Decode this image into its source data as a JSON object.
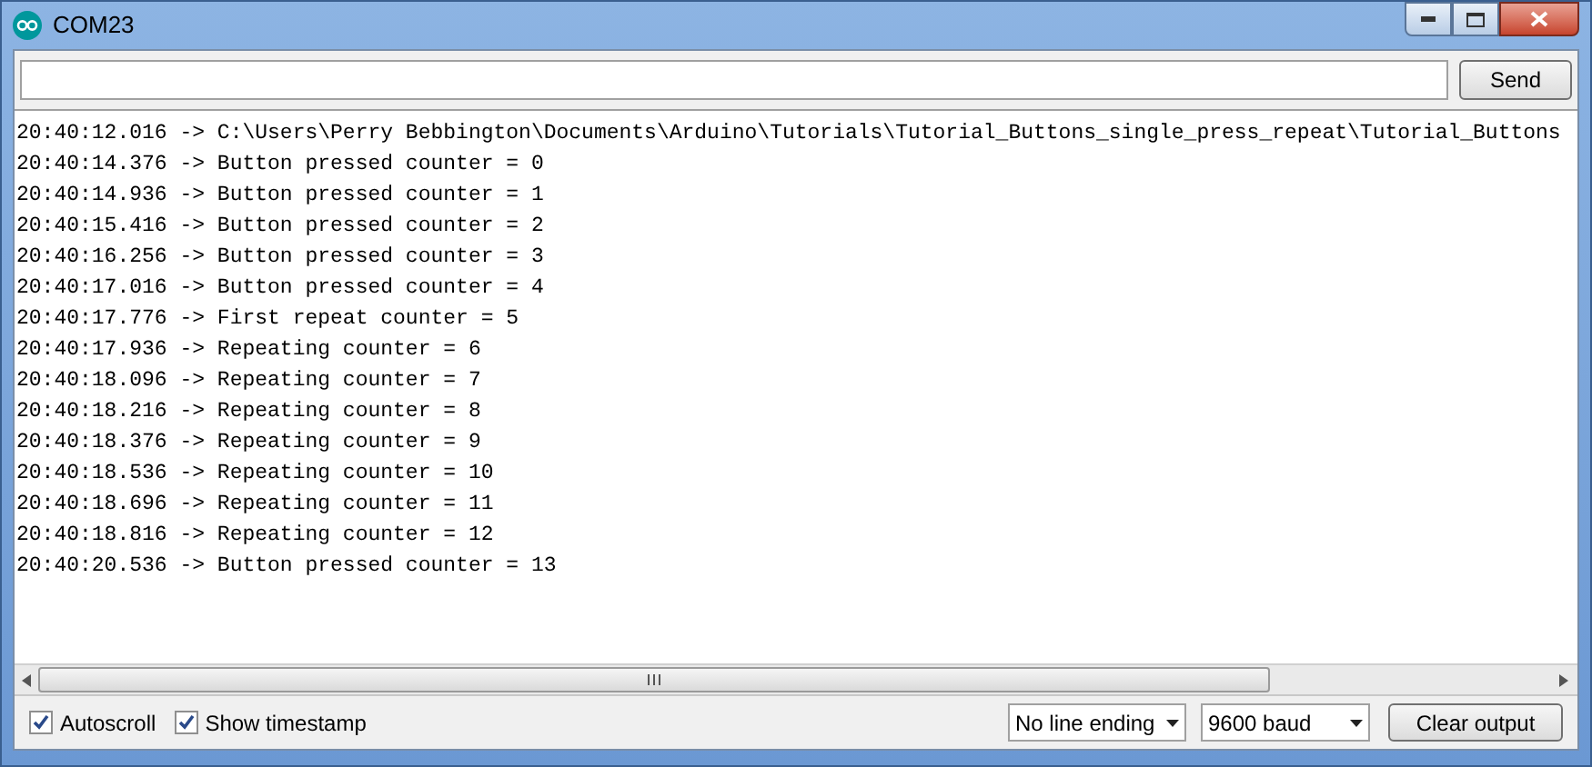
{
  "window": {
    "title": "COM23"
  },
  "send_button": "Send",
  "output_lines": [
    "20:40:12.016 -> C:\\Users\\Perry Bebbington\\Documents\\Arduino\\Tutorials\\Tutorial_Buttons_single_press_repeat\\Tutorial_Buttons",
    "20:40:14.376 -> Button pressed counter = 0",
    "20:40:14.936 -> Button pressed counter = 1",
    "20:40:15.416 -> Button pressed counter = 2",
    "20:40:16.256 -> Button pressed counter = 3",
    "20:40:17.016 -> Button pressed counter = 4",
    "20:40:17.776 -> First repeat counter = 5",
    "20:40:17.936 -> Repeating counter = 6",
    "20:40:18.096 -> Repeating counter = 7",
    "20:40:18.216 -> Repeating counter = 8",
    "20:40:18.376 -> Repeating counter = 9",
    "20:40:18.536 -> Repeating counter = 10",
    "20:40:18.696 -> Repeating counter = 11",
    "20:40:18.816 -> Repeating counter = 12",
    "20:40:20.536 -> Button pressed counter = 13"
  ],
  "checkboxes": [
    {
      "label": "Autoscroll",
      "checked": true
    },
    {
      "label": "Show timestamp",
      "checked": true
    }
  ],
  "dropdowns": [
    {
      "value": "No line ending"
    },
    {
      "value": "9600 baud"
    }
  ],
  "clear_button": "Clear output"
}
